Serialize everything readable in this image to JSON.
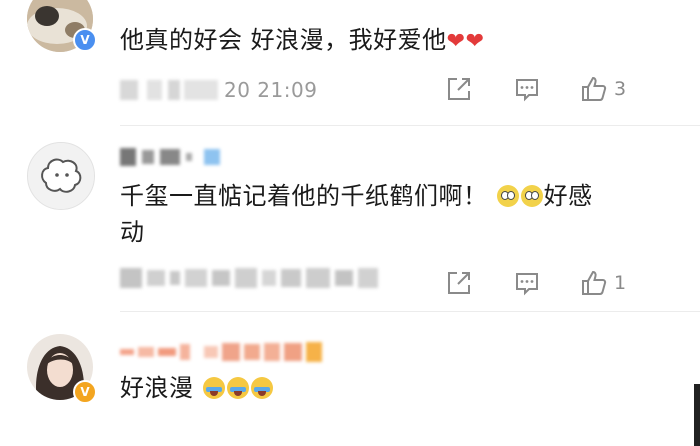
{
  "comments": [
    {
      "text_main": "他真的好会 好浪漫，我好爱他",
      "text_hearts": "❤❤",
      "time": "20 21:09",
      "actions": {
        "like_count": "3"
      },
      "avatar_verified": "V"
    },
    {
      "text_line1_a": "千玺一直惦记着他的千纸鹤们啊！",
      "text_line1_b": "好感",
      "text_line2": "动",
      "actions": {
        "like_count": "1"
      }
    },
    {
      "text": "好浪漫",
      "avatar_verified": "V"
    }
  ],
  "icons": {
    "share": "share-icon",
    "comment": "comment-icon",
    "like": "thumbs-up-icon"
  },
  "colors": {
    "verified_blue": "#4a8ff0",
    "verified_gold": "#f3a520",
    "heart": "#e33a3a",
    "meta_gray": "#9a9a9a"
  }
}
